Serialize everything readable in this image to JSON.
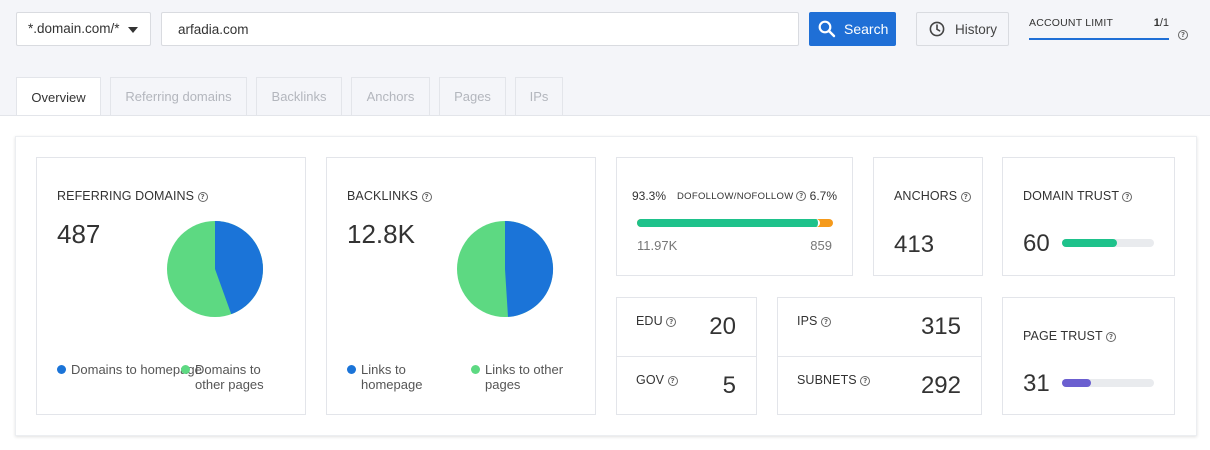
{
  "topbar": {
    "scope_value": "*.domain.com/*",
    "domain_value": "arfadia.com",
    "search_label": "Search",
    "history_label": "History",
    "account_limit_label": "ACCOUNT LIMIT",
    "account_limit_used": "1",
    "account_limit_total": "/1"
  },
  "tabs": [
    {
      "label": "Overview",
      "active": true
    },
    {
      "label": "Referring domains",
      "active": false
    },
    {
      "label": "Backlinks",
      "active": false
    },
    {
      "label": "Anchors",
      "active": false
    },
    {
      "label": "Pages",
      "active": false
    },
    {
      "label": "IPs",
      "active": false
    }
  ],
  "referring_domains": {
    "title": "REFERRING DOMAINS",
    "value": "487",
    "homepage_fraction": 0.445,
    "legend": [
      {
        "label": "Domains to homepage",
        "color": "#1b74d8"
      },
      {
        "label": "Domains to other pages",
        "color": "#5dd982"
      }
    ]
  },
  "backlinks": {
    "title": "BACKLINKS",
    "value": "12.8K",
    "homepage_fraction": 0.49,
    "legend": [
      {
        "label": "Links to homepage",
        "color": "#1b74d8"
      },
      {
        "label": "Links to other pages",
        "color": "#5dd982"
      }
    ]
  },
  "dofollow": {
    "label": "DOFOLLOW/NOFOLLOW",
    "dofollow_pct": "93.3%",
    "nofollow_pct": "6.7%",
    "dofollow_count": "11.97K",
    "nofollow_count": "859",
    "dofollow_fraction": 0.933,
    "dofollow_color": "#1ec28b",
    "nofollow_color": "#f59a1b"
  },
  "anchors": {
    "title": "ANCHORS",
    "value": "413"
  },
  "domain_trust": {
    "title": "DOMAIN TRUST",
    "value": "60",
    "fraction": 0.6,
    "color": "#1ec28b"
  },
  "page_trust": {
    "title": "PAGE TRUST",
    "value": "31",
    "fraction": 0.31,
    "color": "#6b5fd0"
  },
  "edu": {
    "title": "EDU",
    "value": "20"
  },
  "gov": {
    "title": "GOV",
    "value": "5"
  },
  "ips": {
    "title": "IPS",
    "value": "315"
  },
  "subnets": {
    "title": "SUBNETS",
    "value": "292"
  },
  "icons": {
    "search": "search-icon",
    "history": "clock-icon",
    "help": "help-circle-icon",
    "dropdown": "caret-down-icon"
  }
}
